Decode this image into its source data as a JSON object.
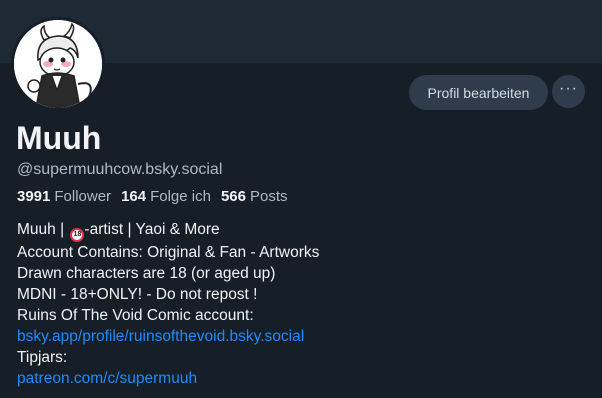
{
  "profile": {
    "display_name": "Muuh",
    "handle": "@supermuuhcow.bsky.social",
    "edit_button": "Profil bearbeiten",
    "more_button": "···"
  },
  "stats": {
    "followers_count": "3991",
    "followers_label": "Follower",
    "following_count": "164",
    "following_label": "Folge ich",
    "posts_count": "566",
    "posts_label": "Posts"
  },
  "bio": {
    "line1_pre": "Muuh | ",
    "line1_emoji": "18",
    "line1_post": "-artist | Yaoi & More",
    "line2": "Account Contains: Original & Fan - Artworks",
    "line3": "Drawn characters are 18 (or aged up)",
    "line4": "MDNI - 18+ONLY! - Do not repost !",
    "line5": "Ruins Of The Void Comic account:",
    "link1": "bsky.app/profile/ruinsofthevoid.bsky.social",
    "line7": "Tipjars:",
    "link2": "patreon.com/c/supermuuh"
  },
  "colors": {
    "background": "#161e27",
    "banner": "#1e2936",
    "button": "#2e3c4c",
    "link": "#208bfe",
    "muted_text": "#aebbc9"
  }
}
